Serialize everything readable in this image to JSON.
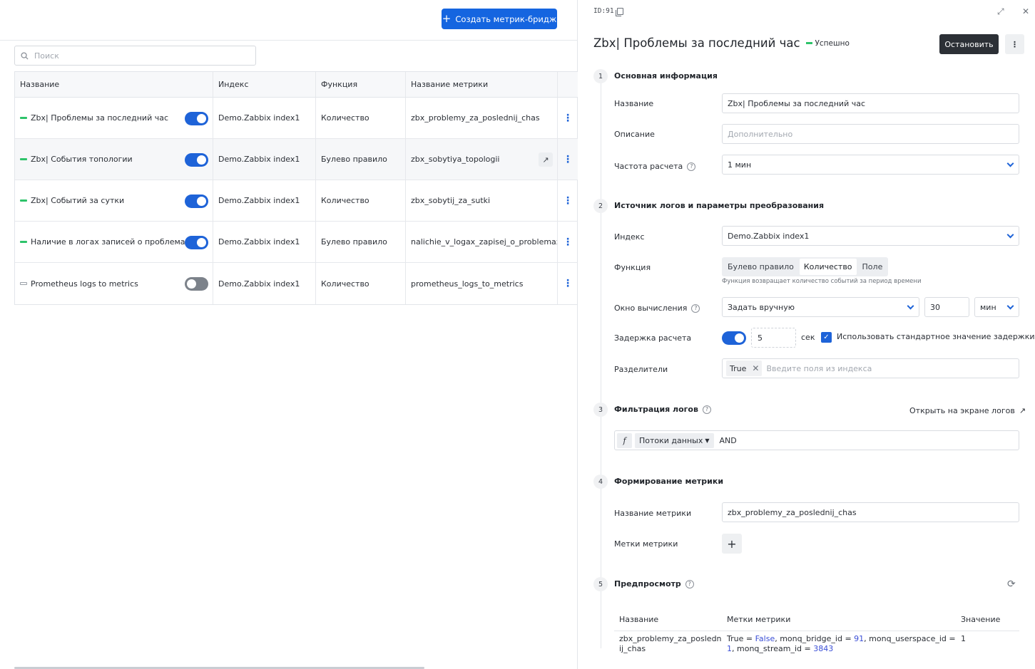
{
  "list": {
    "create_button": "Создать метрик-бридж",
    "search_placeholder": "Поиск",
    "columns": [
      "Название",
      "Индекс",
      "Функция",
      "Название метрики"
    ],
    "rows": [
      {
        "name": "Zbx| Проблемы за последний час",
        "index": "Demo.Zabbix index1",
        "function": "Количество",
        "metric": "zbx_problemy_za_poslednij_chas",
        "enabled": true
      },
      {
        "name": "Zbx| События топологии",
        "index": "Demo.Zabbix index1",
        "function": "Булево правило",
        "metric": "zbx_sobytiya_topologii",
        "enabled": true
      },
      {
        "name": "Zbx| Событий за сутки",
        "index": "Demo.Zabbix index1",
        "function": "Количество",
        "metric": "zbx_sobytij_za_sutki",
        "enabled": true
      },
      {
        "name": "Наличие в логах записей о проблемах",
        "index": "Demo.Zabbix index1",
        "function": "Булево правило",
        "metric": "nalichie_v_logax_zapisej_o_problemax",
        "enabled": true
      },
      {
        "name": "Prometheus logs to metrics",
        "index": "Demo.Zabbix index1",
        "function": "Количество",
        "metric": "prometheus_logs_to_metrics",
        "enabled": false
      }
    ]
  },
  "detail": {
    "id_label": "ID:91",
    "title": "Zbx| Проблемы за последний час",
    "status": "Успешно",
    "stop_button": "Остановить",
    "sections": {
      "s1": {
        "num": "1",
        "title": "Основная информация"
      },
      "s2": {
        "num": "2",
        "title": "Источник логов и параметры преобразования"
      },
      "s3": {
        "num": "3",
        "title": "Фильтрация логов"
      },
      "s4": {
        "num": "4",
        "title": "Формирование метрики"
      },
      "s5": {
        "num": "5",
        "title": "Предпросмотр"
      }
    },
    "fields": {
      "name_label": "Название",
      "name_value": "Zbx| Проблемы за последний час",
      "desc_label": "Описание",
      "desc_placeholder": "Дополнительно",
      "freq_label": "Частота расчета",
      "freq_value": "1 мин",
      "index_label": "Индекс",
      "index_value": "Demo.Zabbix index1",
      "func_label": "Функция",
      "func_options": [
        "Булево правило",
        "Количество",
        "Поле"
      ],
      "func_hint": "Функция возвращает количество событий за период времени",
      "window_label": "Окно вычисления",
      "window_mode": "Задать вручную",
      "window_value": "30",
      "window_unit": "мин",
      "delay_label": "Задержка расчета",
      "delay_value": "5",
      "delay_unit": "сек",
      "delay_default_label": "Использовать стандартное значение задержки",
      "sep_label": "Разделители",
      "sep_chip": "True",
      "sep_placeholder": "Введите поля из индекса",
      "open_logs": "Открыть на экране логов",
      "streams": "Потоки данных",
      "and": "AND",
      "metric_name_label": "Название метрики",
      "metric_name_value": "zbx_problemy_za_poslednij_chas",
      "metric_tags_label": "Метки метрики"
    },
    "preview": {
      "columns": [
        "Название",
        "Метки метрики",
        "Значение"
      ],
      "row": {
        "name": "zbx_problemy_za_poslednij_chas",
        "tags": [
          {
            "key": "True",
            "value": "False"
          },
          {
            "key": "monq_bridge_id",
            "value": "91"
          },
          {
            "key": "monq_userspace_id",
            "value": "1"
          },
          {
            "key": "monq_stream_id",
            "value": "3843"
          }
        ],
        "value": "1"
      }
    }
  }
}
